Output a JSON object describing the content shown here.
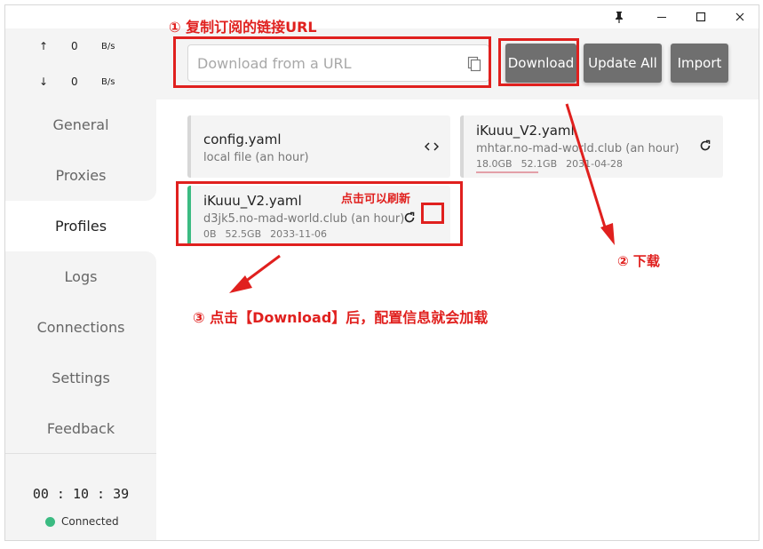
{
  "speed": {
    "up_arrow": "↑",
    "up_value": "0",
    "up_unit": "B/s",
    "down_arrow": "↓",
    "down_value": "0",
    "down_unit": "B/s"
  },
  "nav": {
    "items": [
      {
        "label": "General"
      },
      {
        "label": "Proxies"
      },
      {
        "label": "Profiles"
      },
      {
        "label": "Logs"
      },
      {
        "label": "Connections"
      },
      {
        "label": "Settings"
      },
      {
        "label": "Feedback"
      }
    ],
    "active": "Profiles"
  },
  "status": {
    "timer": "00 : 10 : 39",
    "connection": "Connected",
    "connection_color": "#3bbb82"
  },
  "titlebar": {
    "pin_icon": "pin-icon",
    "minimize_icon": "minimize-icon",
    "maximize_icon": "maximize-icon",
    "close_icon": "close-icon"
  },
  "toolbar": {
    "url_placeholder": "Download from a URL",
    "url_value": "",
    "download_label": "Download",
    "update_all_label": "Update All",
    "import_label": "Import"
  },
  "profiles": [
    {
      "name": "config.yaml",
      "subtitle": "local file (an hour)",
      "action_icon": "code-icon",
      "selected": false
    },
    {
      "name": "iKuuu_V2.yaml",
      "subtitle": "mhtar.no-mad-world.club (an hour)",
      "used": "18.0GB",
      "total": "52.1GB",
      "expire": "2031-04-28",
      "usage_fraction": 0.35,
      "action_icon": "refresh-icon",
      "selected": false
    },
    {
      "name": "iKuuu_V2.yaml",
      "subtitle": "d3jk5.no-mad-world.club (an hour)",
      "used": "0B",
      "total": "52.5GB",
      "expire": "2033-11-06",
      "usage_fraction": 0,
      "action_icon": "refresh-icon",
      "selected": true
    }
  ],
  "annotations": {
    "step1": "① 复制订阅的链接URL",
    "step2": "② 下载",
    "step3": "③ 点击【Download】后，配置信息就会加载",
    "refresh_hint": "点击可以刷新",
    "color": "#e0201e"
  }
}
